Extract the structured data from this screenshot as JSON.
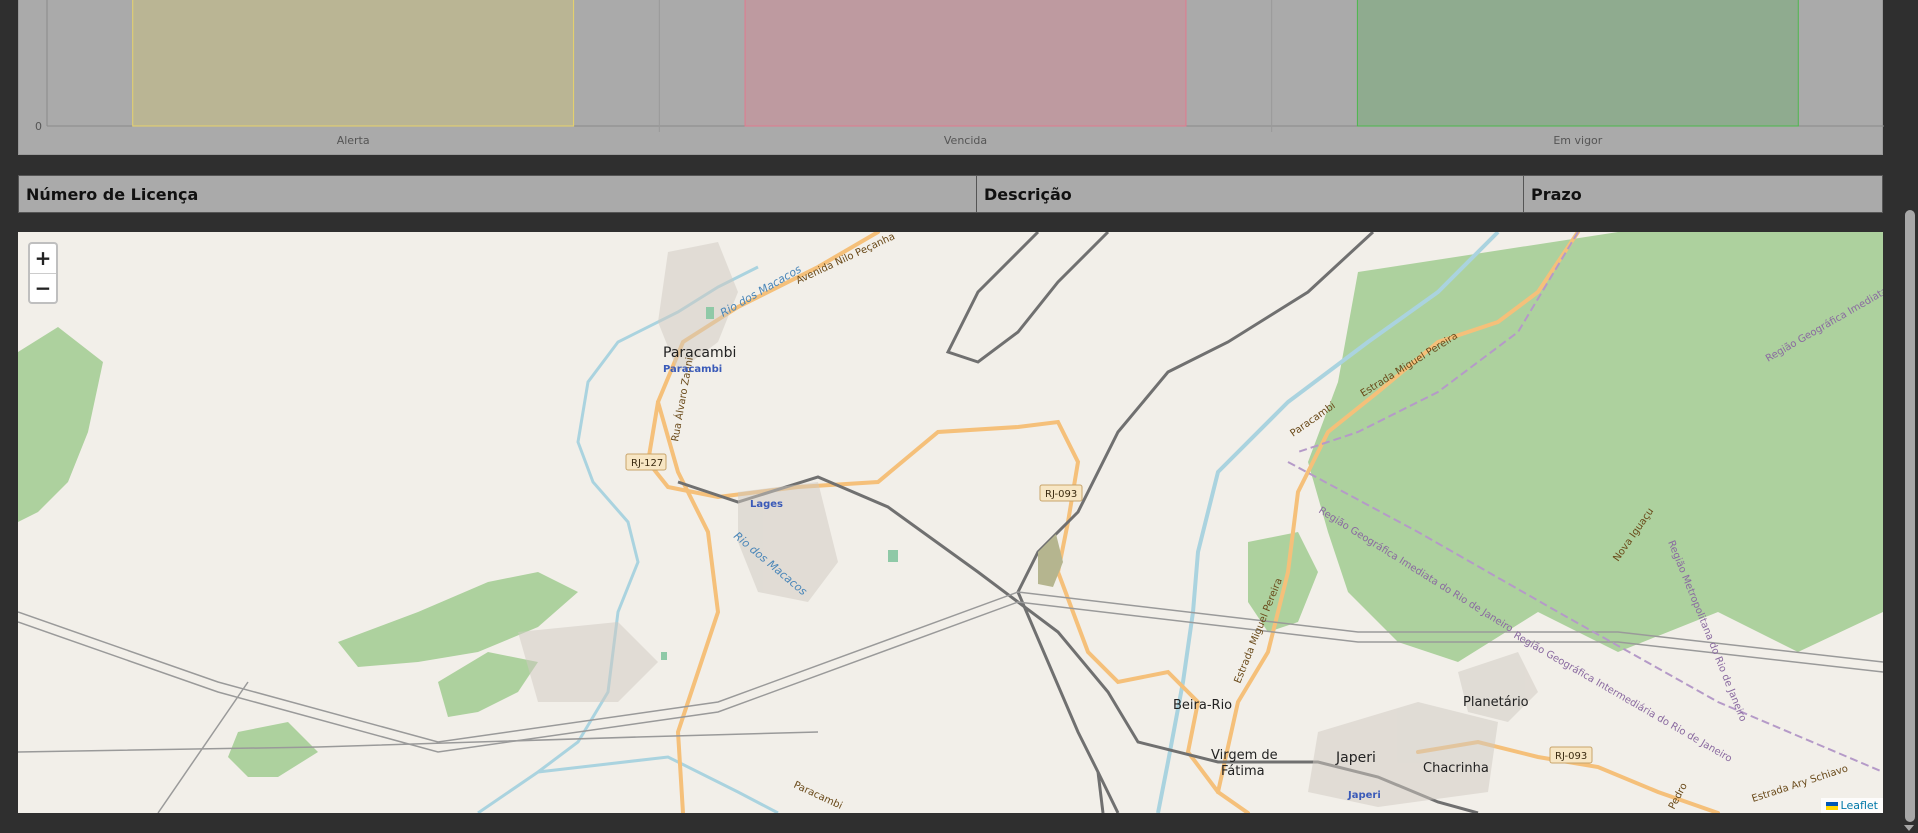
{
  "chart_data": {
    "type": "bar",
    "categories": [
      "Alerta",
      "Vencida",
      "Em vigor"
    ],
    "y_tick": "0",
    "colors": [
      "#bab594",
      "#be9aa0",
      "#8fab8f"
    ],
    "border_colors": [
      "#e8d36a",
      "#e07a8e",
      "#4cb84c"
    ]
  },
  "table": {
    "headers": [
      "Número de Licença",
      "Descrição",
      "Prazo"
    ]
  },
  "map": {
    "zoom_in": "+",
    "zoom_out": "−",
    "attribution": "Leaflet",
    "places": {
      "paracambi": "Paracambi",
      "paracambi_station": "Paracambi",
      "lages": "Lages",
      "beira_rio": "Beira-Rio",
      "virgem_1": "Virgem de",
      "virgem_2": "Fátima",
      "japeri": "Japeri",
      "japeri_station": "Japeri",
      "chacrinha": "Chacrinha",
      "planetario": "Planetário"
    },
    "roads": {
      "rj127": "RJ-127",
      "rj093a": "RJ-093",
      "rj093b": "RJ-093",
      "nilo": "Avenida Nilo Peçanha",
      "alvaro": "Rua Álvaro Zanni",
      "miguel": "Estrada Miguel Pereira",
      "miguel2": "Estrada Miguel Pereira",
      "ary": "Estrada Ary Schiavo",
      "novaiguacu": "Nova Iguaçu",
      "pedro": "Pedro",
      "paracambi_rail": "Paracambi",
      "paracambi_rail2": "Paracambi"
    },
    "water": {
      "rio1": "Rio dos Macacos",
      "rio2": "Rio dos Macacos"
    },
    "regions": {
      "r1": "Região Geográfica Imediata do Rio de Janeiro",
      "r2": "Região Geográfica Intermediária do Rio de Janeiro",
      "r3": "Região Metropolitana do Rio de Janeiro",
      "r4": "Região Geográfica Imediata"
    }
  }
}
